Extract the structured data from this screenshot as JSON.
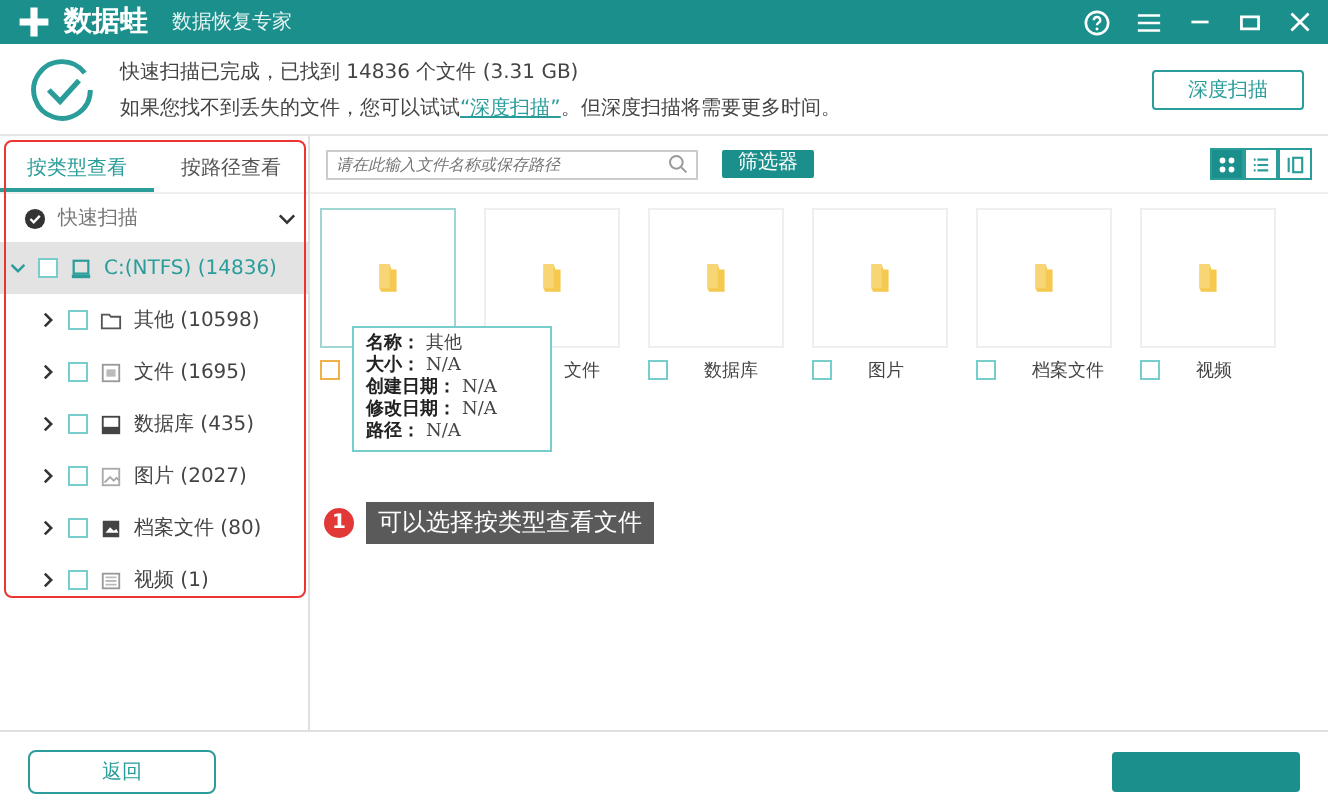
{
  "app": {
    "title": "数据蛙",
    "subtitle": "数据恢复专家"
  },
  "scan": {
    "status": "快速扫描已完成，已找到 14836 个文件 (3.31 GB)",
    "hint_before": "如果您找不到丢失的文件，您可以试试",
    "hint_link": "“深度扫描”",
    "hint_after": "。但深度扫描将需要更多时间。",
    "button": "深度扫描"
  },
  "tabs": [
    {
      "label": "按类型查看",
      "selected": true
    },
    {
      "label": "按路径查看",
      "selected": false
    }
  ],
  "scan_mode": {
    "label": "快速扫描"
  },
  "tree": {
    "label": "C:(NTFS) (14836)",
    "checked": false,
    "expanded": true,
    "selected": true,
    "children": [
      {
        "label": "其他 (10598)",
        "kind": "folder",
        "checked": false,
        "expanded": false
      },
      {
        "label": "文件 (1695)",
        "kind": "document",
        "checked": false,
        "expanded": false
      },
      {
        "label": "数据库 (435)",
        "kind": "database",
        "checked": false,
        "expanded": false
      },
      {
        "label": "图片 (2027)",
        "kind": "image",
        "checked": false,
        "expanded": false
      },
      {
        "label": "档案文件 (80)",
        "kind": "archive",
        "checked": false,
        "expanded": false
      },
      {
        "label": "视频 (1)",
        "kind": "video",
        "checked": false,
        "expanded": false
      }
    ]
  },
  "search": {
    "placeholder": "请在此输入文件名称或保存路径"
  },
  "filter_button": "筛选器",
  "view_modes": [
    {
      "kind": "grid",
      "selected": true
    },
    {
      "kind": "list",
      "selected": false
    },
    {
      "kind": "detail",
      "selected": false
    }
  ],
  "items": [
    {
      "hovered": true,
      "checked": false
    },
    {
      "label": "文件",
      "hovered": false
    },
    {
      "label": "数据库",
      "hovered": false,
      "checked": false
    },
    {
      "label": "图片",
      "hovered": false,
      "checked": false
    },
    {
      "label": "档案文件",
      "hovered": false,
      "checked": false
    },
    {
      "label": "视频",
      "hovered": false,
      "checked": false
    }
  ],
  "tooltip": [
    {
      "label": "名称：",
      "value": "其他"
    },
    {
      "label": "大小：",
      "value": "N/A"
    },
    {
      "label": "创建日期：",
      "value": "N/A"
    },
    {
      "label": "修改日期：",
      "value": "N/A"
    },
    {
      "label": "路径：",
      "value": "N/A"
    }
  ],
  "callout": {
    "number": "1",
    "text": "可以选择按类型查看文件"
  },
  "back_button": "返回"
}
